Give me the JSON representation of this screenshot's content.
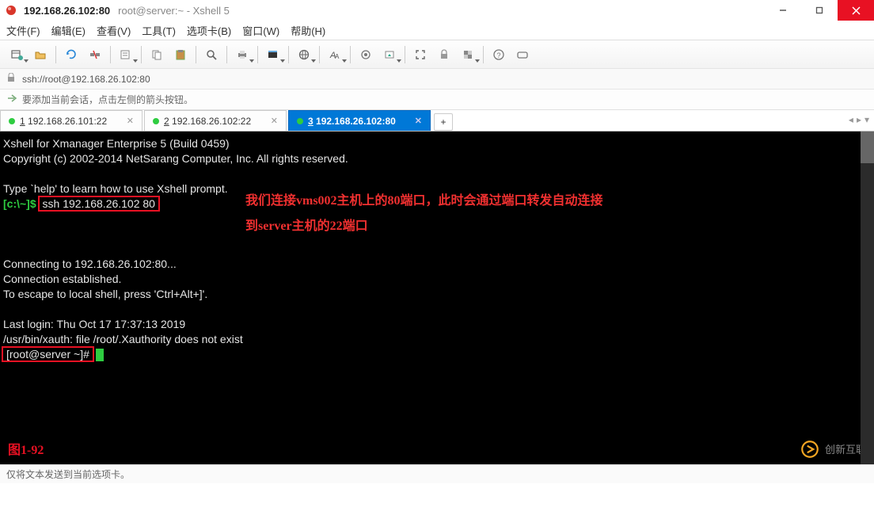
{
  "window": {
    "title_main": "192.168.26.102:80",
    "title_sub": "root@server:~ - Xshell 5"
  },
  "menu": {
    "file": "文件(F)",
    "edit": "编辑(E)",
    "view": "查看(V)",
    "tools": "工具(T)",
    "tabs": "选项卡(B)",
    "window": "窗口(W)",
    "help": "帮助(H)"
  },
  "addressbar": {
    "url": "ssh://root@192.168.26.102:80"
  },
  "hint": {
    "text": "要添加当前会话，点击左侧的箭头按钮。"
  },
  "tabs": [
    {
      "index": "1",
      "label": "192.168.26.101:22"
    },
    {
      "index": "2",
      "label": "192.168.26.102:22"
    },
    {
      "index": "3",
      "label": "192.168.26.102:80"
    }
  ],
  "terminal": {
    "banner1": "Xshell for Xmanager Enterprise 5 (Build 0459)",
    "banner2": "Copyright (c) 2002-2014 NetSarang Computer, Inc. All rights reserved.",
    "help_hint": "Type `help' to learn how to use Xshell prompt.",
    "local_prompt": "[c:\\~]$",
    "ssh_cmd": "ssh 192.168.26.102 80",
    "annotation1": "我们连接vms002主机上的80端口，此时会通过端口转发自动连接",
    "annotation2": "到server主机的22端口",
    "connecting": "Connecting to 192.168.26.102:80...",
    "established": "Connection established.",
    "escape": "To escape to local shell, press 'Ctrl+Alt+]'.",
    "lastlogin": "Last login: Thu Oct 17 17:37:13 2019",
    "xauth": "/usr/bin/xauth:  file /root/.Xauthority does not exist",
    "server_prompt": "[root@server ~]#",
    "figure_label": "图1-92",
    "watermark": "创新互联"
  },
  "status": {
    "text": "仅将文本发送到当前选项卡。"
  }
}
